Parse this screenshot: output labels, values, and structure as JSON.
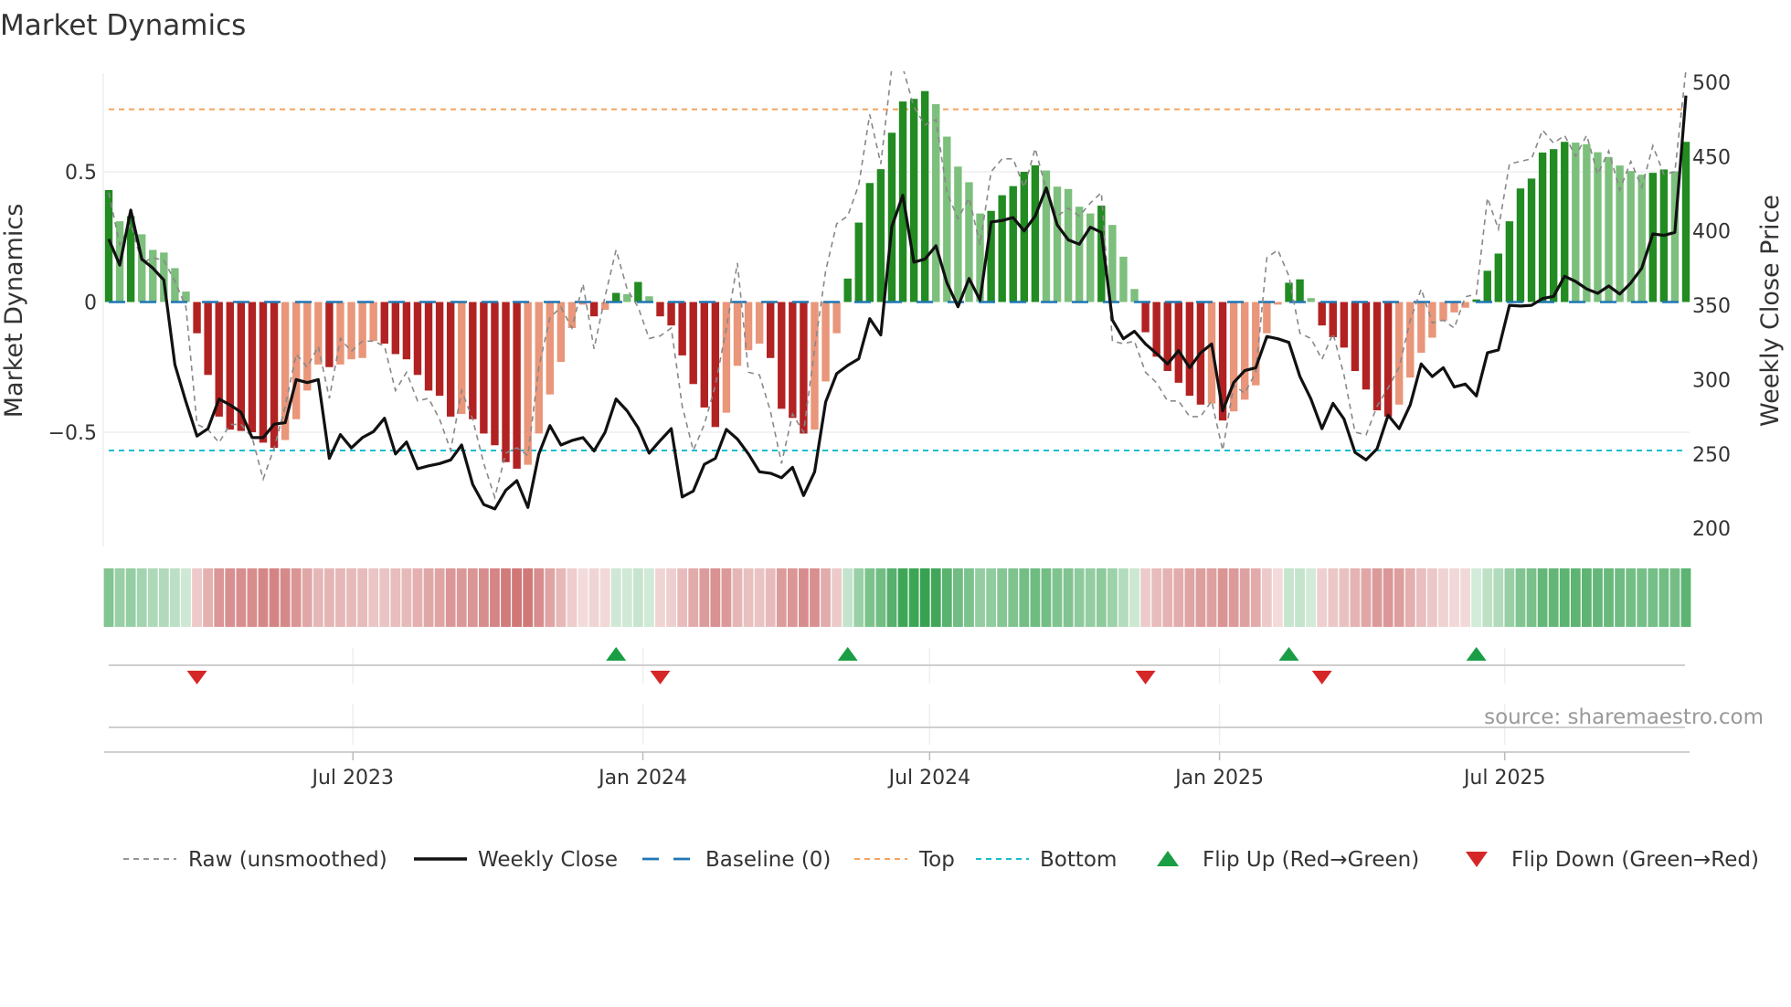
{
  "title": "Market Dynamics",
  "source": "source: sharemaestro.com",
  "colors": {
    "dark_green": "#228b22",
    "light_green": "#7dbf7d",
    "dark_red": "#b22222",
    "light_red": "#e9967a",
    "close": "#111111",
    "raw": "#888888",
    "baseline": "#1f77b4",
    "top": "#f4a460",
    "bottom": "#17becf",
    "flip_up": "#1a9e45",
    "flip_down": "#d62728",
    "heat_green": "#2f9e4a",
    "heat_red": "#c45555"
  },
  "legend": [
    {
      "key": "raw",
      "label": "Raw (unsmoothed)"
    },
    {
      "key": "close",
      "label": "Weekly Close"
    },
    {
      "key": "baseline",
      "label": "Baseline (0)"
    },
    {
      "key": "top",
      "label": "Top"
    },
    {
      "key": "bottom",
      "label": "Bottom"
    },
    {
      "key": "flip_up",
      "label": "Flip Up (Red→Green)"
    },
    {
      "key": "flip_down",
      "label": "Flip Down (Green→Red)"
    }
  ],
  "chart_data": {
    "type": "bar",
    "title": "Market Dynamics",
    "xlabel": "",
    "ylabel": "Market Dynamics",
    "y2label": "Weekly Close Price",
    "start_week": "2023-01-27",
    "frequency": "weekly",
    "ylim": [
      -0.87,
      0.88
    ],
    "y2lim": [
      200,
      505
    ],
    "yticks": [
      {
        "v": 0.5,
        "label": "0.5"
      },
      {
        "v": 0,
        "label": "0"
      },
      {
        "v": -0.5,
        "label": "−0.5"
      }
    ],
    "y2ticks": [
      {
        "v": 500,
        "label": "500"
      },
      {
        "v": 450,
        "label": "450"
      },
      {
        "v": 400,
        "label": "400"
      },
      {
        "v": 350,
        "label": "350"
      },
      {
        "v": 300,
        "label": "300"
      },
      {
        "v": 250,
        "label": "250"
      },
      {
        "v": 200,
        "label": "200"
      }
    ],
    "xticks": [
      {
        "date": "2023-07-01",
        "label": "Jul 2023"
      },
      {
        "date": "2024-01-01",
        "label": "Jan 2024"
      },
      {
        "date": "2024-07-01",
        "label": "Jul 2024"
      },
      {
        "date": "2025-01-01",
        "label": "Jan 2025"
      },
      {
        "date": "2025-07-01",
        "label": "Jul 2025"
      }
    ],
    "top_level": 0.74,
    "bottom_level": -0.57,
    "baseline": 0,
    "dynamics": [
      0.43,
      0.31,
      0.33,
      0.26,
      0.2,
      0.19,
      0.13,
      0.04,
      -0.12,
      -0.28,
      -0.44,
      -0.49,
      -0.495,
      -0.5,
      -0.54,
      -0.56,
      -0.53,
      -0.45,
      -0.34,
      -0.24,
      -0.25,
      -0.24,
      -0.22,
      -0.215,
      -0.15,
      -0.16,
      -0.2,
      -0.22,
      -0.28,
      -0.34,
      -0.36,
      -0.44,
      -0.43,
      -0.45,
      -0.505,
      -0.55,
      -0.615,
      -0.64,
      -0.625,
      -0.505,
      -0.355,
      -0.23,
      -0.1,
      -0.01,
      -0.055,
      -0.03,
      0.035,
      0.03,
      0.077,
      0.022,
      -0.055,
      -0.09,
      -0.205,
      -0.315,
      -0.405,
      -0.48,
      -0.425,
      -0.245,
      -0.185,
      -0.16,
      -0.215,
      -0.41,
      -0.445,
      -0.505,
      -0.49,
      -0.305,
      -0.12,
      0.09,
      0.305,
      0.457,
      0.51,
      0.65,
      0.77,
      0.78,
      0.81,
      0.76,
      0.635,
      0.52,
      0.46,
      0.34,
      0.35,
      0.41,
      0.445,
      0.5,
      0.525,
      0.505,
      0.443,
      0.434,
      0.366,
      0.34,
      0.37,
      0.296,
      0.174,
      0.05,
      -0.116,
      -0.21,
      -0.265,
      -0.31,
      -0.36,
      -0.394,
      -0.39,
      -0.455,
      -0.42,
      -0.375,
      -0.32,
      -0.12,
      -0.01,
      0.074,
      0.087,
      0.015,
      -0.09,
      -0.135,
      -0.175,
      -0.265,
      -0.336,
      -0.416,
      -0.44,
      -0.394,
      -0.29,
      -0.195,
      -0.137,
      -0.072,
      -0.04,
      -0.022,
      0.01,
      0.12,
      0.186,
      0.31,
      0.436,
      0.474,
      0.574,
      0.587,
      0.615,
      0.612,
      0.606,
      0.575,
      0.557,
      0.524,
      0.503,
      0.489,
      0.496,
      0.509,
      0.502,
      0.615
    ],
    "raw": [
      0.42,
      0.22,
      0.3,
      0.15,
      0.17,
      0.16,
      0.08,
      -0.02,
      -0.47,
      -0.49,
      -0.54,
      -0.47,
      -0.47,
      -0.52,
      -0.68,
      -0.56,
      -0.4,
      -0.2,
      -0.25,
      -0.17,
      -0.37,
      -0.14,
      -0.19,
      -0.15,
      -0.15,
      -0.17,
      -0.34,
      -0.27,
      -0.38,
      -0.37,
      -0.45,
      -0.57,
      -0.34,
      -0.45,
      -0.62,
      -0.75,
      -0.58,
      -0.56,
      -0.59,
      -0.25,
      -0.06,
      -0.02,
      -0.1,
      0.07,
      -0.18,
      0.02,
      0.2,
      0.05,
      -0.02,
      -0.14,
      -0.13,
      -0.1,
      -0.4,
      -0.57,
      -0.47,
      -0.32,
      -0.1,
      0.15,
      -0.27,
      -0.28,
      -0.42,
      -0.62,
      -0.43,
      -0.5,
      -0.18,
      0.12,
      0.3,
      0.33,
      0.45,
      0.72,
      0.53,
      0.9,
      0.9,
      0.75,
      0.68,
      0.7,
      0.42,
      0.32,
      0.4,
      0.22,
      0.5,
      0.55,
      0.55,
      0.44,
      0.59,
      0.43,
      0.33,
      0.36,
      0.33,
      0.38,
      0.42,
      -0.15,
      -0.16,
      -0.15,
      -0.27,
      -0.31,
      -0.38,
      -0.38,
      -0.44,
      -0.44,
      -0.38,
      -0.57,
      -0.32,
      -0.35,
      -0.27,
      0.17,
      0.2,
      0.1,
      -0.12,
      -0.14,
      -0.22,
      -0.12,
      -0.28,
      -0.5,
      -0.51,
      -0.4,
      -0.33,
      -0.25,
      -0.07,
      0.05,
      -0.08,
      -0.07,
      -0.1,
      0.02,
      0.03,
      0.4,
      0.28,
      0.53,
      0.54,
      0.55,
      0.66,
      0.61,
      0.64,
      0.56,
      0.64,
      0.49,
      0.58,
      0.43,
      0.54,
      0.44,
      0.6,
      0.49,
      0.5,
      0.89
    ],
    "weekly_close": [
      394.5,
      377,
      414,
      381,
      375,
      367,
      310,
      285,
      262,
      267,
      287,
      283,
      278,
      261,
      261,
      270,
      271,
      300,
      298,
      300,
      247,
      263,
      254,
      261,
      265,
      274,
      250,
      258,
      240,
      242,
      243.5,
      246,
      256,
      229.5,
      216,
      213,
      225.5,
      232,
      214,
      250,
      269,
      256,
      259,
      261,
      252,
      264.5,
      287,
      279,
      267.5,
      250.5,
      259,
      267,
      221,
      225,
      243,
      247,
      266.5,
      260,
      250,
      238,
      237,
      234,
      241,
      222,
      238,
      285,
      304,
      309.5,
      314,
      341,
      330,
      403,
      424,
      379,
      381,
      390,
      365,
      349,
      368,
      353.5,
      406,
      407,
      409,
      400,
      410,
      429,
      404,
      394,
      391,
      402.5,
      399,
      340,
      327.5,
      332.5,
      324,
      317.5,
      310.5,
      319.5,
      308,
      318,
      324,
      279,
      298,
      306,
      308,
      329,
      327.5,
      325,
      302,
      287,
      267,
      284,
      273.5,
      251,
      246,
      253.5,
      276,
      267,
      283,
      310.5,
      302,
      308,
      295,
      297,
      289,
      318,
      320,
      350,
      349.5,
      350,
      354.5,
      356,
      369.5,
      366,
      361,
      358,
      363,
      357.5,
      365,
      375,
      398,
      397,
      399,
      491
    ]
  }
}
